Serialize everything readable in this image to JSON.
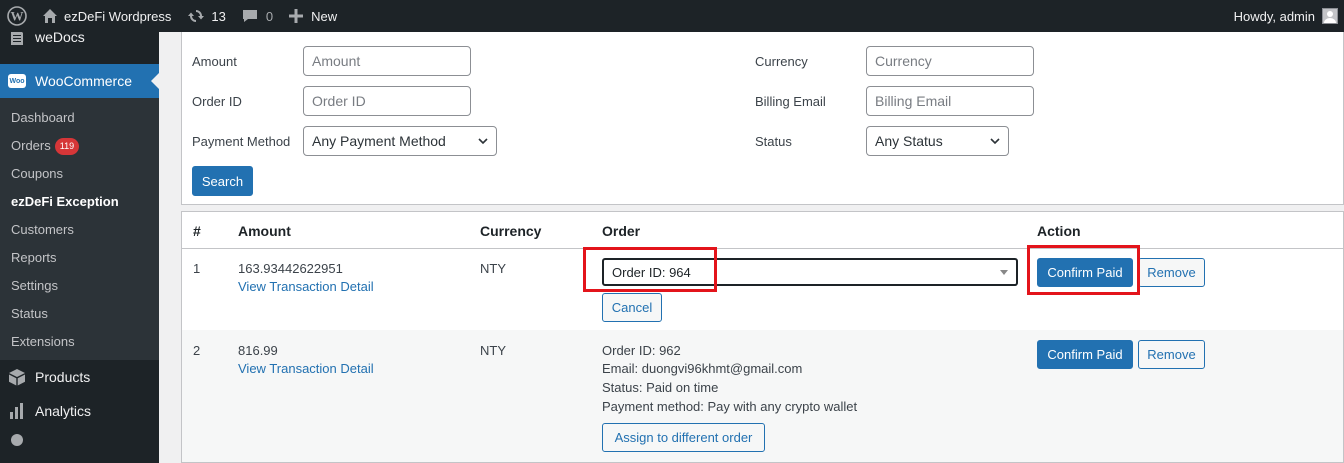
{
  "adminbar": {
    "site_name": "ezDeFi Wordpress",
    "updates_count": "13",
    "comments_count": "0",
    "new_label": "New",
    "greeting": "Howdy, admin"
  },
  "sidebar": {
    "wedocs_label": "weDocs",
    "woocommerce_label": "WooCommerce",
    "woo_logo_text": "Woo",
    "submenu": [
      {
        "label": "Dashboard"
      },
      {
        "label": "Orders",
        "badge": "119"
      },
      {
        "label": "Coupons"
      },
      {
        "label": "ezDeFi Exception",
        "current": true
      },
      {
        "label": "Customers"
      },
      {
        "label": "Reports"
      },
      {
        "label": "Settings"
      },
      {
        "label": "Status"
      },
      {
        "label": "Extensions"
      }
    ],
    "products_label": "Products",
    "analytics_label": "Analytics"
  },
  "filters": {
    "amount_label": "Amount",
    "amount_placeholder": "Amount",
    "order_id_label": "Order ID",
    "order_id_placeholder": "Order ID",
    "payment_method_label": "Payment Method",
    "payment_method_value": "Any Payment Method",
    "currency_label": "Currency",
    "currency_placeholder": "Currency",
    "billing_email_label": "Billing Email",
    "billing_email_placeholder": "Billing Email",
    "status_label": "Status",
    "status_value": "Any Status",
    "search_button": "Search"
  },
  "table": {
    "headers": {
      "num": "#",
      "amount": "Amount",
      "currency": "Currency",
      "order": "Order",
      "action": "Action"
    },
    "rows": [
      {
        "num": "1",
        "amount": "163.93442622951",
        "view_link": "View Transaction Detail",
        "currency": "NTY",
        "order_select_value": "Order ID: 964",
        "cancel_label": "Cancel",
        "confirm_label": "Confirm Paid",
        "remove_label": "Remove"
      },
      {
        "num": "2",
        "amount": "816.99",
        "view_link": "View Transaction Detail",
        "currency": "NTY",
        "order_id": "Order ID: 962",
        "email": "Email: duongvi96khmt@gmail.com",
        "status": "Status: Paid on time",
        "payment_method": "Payment method: Pay with any crypto wallet",
        "assign_label": "Assign to different order",
        "confirm_label": "Confirm Paid",
        "remove_label": "Remove"
      }
    ]
  },
  "colors": {
    "accent": "#2271b1",
    "highlight": "#e3141b",
    "adminbar_bg": "#1d2327",
    "badge": "#d63638"
  }
}
